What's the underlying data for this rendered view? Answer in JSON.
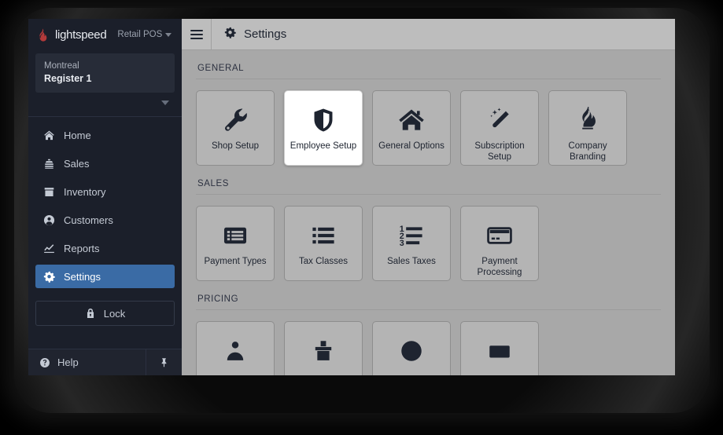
{
  "sidebar": {
    "brand": {
      "name": "lightspeed",
      "app": "Retail POS",
      "logo_icon": "flame-logo-icon",
      "caret_icon": "caret-down-icon",
      "flame_color": "#b33a3a"
    },
    "register": {
      "location": "Montreal",
      "name": "Register 1",
      "expand_icon": "caret-down-icon"
    },
    "nav_items": [
      {
        "label": "Home",
        "icon": "home-icon",
        "active": false
      },
      {
        "label": "Sales",
        "icon": "sales-icon",
        "active": false
      },
      {
        "label": "Inventory",
        "icon": "inventory-box-icon",
        "active": false
      },
      {
        "label": "Customers",
        "icon": "customer-person-icon",
        "active": false
      },
      {
        "label": "Reports",
        "icon": "reports-chart-icon",
        "active": false
      },
      {
        "label": "Settings",
        "icon": "gear-icon",
        "active": true
      }
    ],
    "lock": {
      "label": "Lock",
      "icon": "lock-icon"
    },
    "help": {
      "label": "Help",
      "icon": "help-circle-icon",
      "pin_icon": "pin-icon"
    },
    "active_color": "#3a6ba5",
    "background_color": "#1b1f2a"
  },
  "topbar": {
    "menu_icon": "hamburger-menu-icon",
    "title": "Settings",
    "title_icon": "gear-icon"
  },
  "content": {
    "sections": [
      {
        "heading": "GENERAL",
        "tiles": [
          {
            "label": "Shop Setup",
            "icon": "wrench-icon",
            "selected": false
          },
          {
            "label": "Employee Setup",
            "icon": "shield-icon",
            "selected": true
          },
          {
            "label": "General Options",
            "icon": "house-icon",
            "selected": false
          },
          {
            "label": "Subscription Setup",
            "icon": "magic-wand-icon",
            "selected": false
          },
          {
            "label": "Company Branding",
            "icon": "flame-icon",
            "selected": false
          }
        ]
      },
      {
        "heading": "SALES",
        "tiles": [
          {
            "label": "Payment Types",
            "icon": "payment-list-card-icon",
            "selected": false
          },
          {
            "label": "Tax Classes",
            "icon": "bullet-list-icon",
            "selected": false
          },
          {
            "label": "Sales Taxes",
            "icon": "numbered-list-icon",
            "selected": false
          },
          {
            "label": "Payment Processing",
            "icon": "credit-card-icon",
            "selected": false
          }
        ]
      },
      {
        "heading": "PRICING",
        "tiles": [
          {
            "label": "",
            "icon": "pricing-tile-icon-1",
            "selected": false
          },
          {
            "label": "",
            "icon": "pricing-tile-icon-2",
            "selected": false
          },
          {
            "label": "",
            "icon": "pricing-tile-icon-3",
            "selected": false
          },
          {
            "label": "",
            "icon": "pricing-tile-icon-4",
            "selected": false
          }
        ]
      }
    ]
  }
}
